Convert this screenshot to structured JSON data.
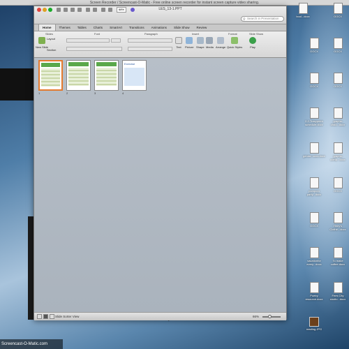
{
  "recorder": {
    "title": "Screen Recorder / Screencast-O-Matic - Free online screen recorder for instant screen capture video sharing."
  },
  "window": {
    "doc_title": "LES_13-1.PPT",
    "zoom_box": "68%",
    "search_placeholder": "Search in Presentation"
  },
  "tabs": [
    "Home",
    "Themes",
    "Tables",
    "Charts",
    "SmartArt",
    "Transitions",
    "Animations",
    "Slide Show",
    "Review"
  ],
  "ribbon": {
    "groups": [
      "Slides",
      "Font",
      "Paragraph",
      "Insert",
      "Format",
      "Slide Show"
    ],
    "buttons": {
      "new_slide": "New Slide",
      "layout": "Layout",
      "section": "Section",
      "text": "Text",
      "picture": "Picture",
      "shape": "Shape",
      "media": "Media",
      "arrange": "Arrange",
      "quick_styles": "Quick Styles",
      "play": "Play"
    }
  },
  "slides": [
    {
      "num": "1",
      "title": ""
    },
    {
      "num": "2",
      "title": ""
    },
    {
      "num": "3",
      "title": ""
    },
    {
      "num": "4",
      "title": "Exercise"
    }
  ],
  "status": {
    "view_label": "Slide Sorter View",
    "zoom": "66%"
  },
  "desktop": {
    "icons": [
      {
        "label": "bool...docx",
        "type": "doc"
      },
      {
        "label": "OOCX",
        "type": "doc"
      },
      {
        "label": "OOCX",
        "type": "doc"
      },
      {
        "label": "OOCX",
        "type": "doc"
      },
      {
        "label": "OOCX",
        "type": "doc"
      },
      {
        "label": "OOCX",
        "type": "doc"
      },
      {
        "label": "2.2.Tracyprem schedule.docx",
        "type": "doc"
      },
      {
        "label": "graphic chdo...docx",
        "type": "doc"
      },
      {
        "label": "gender roles.docx",
        "type": "doc"
      },
      {
        "label": "graphic comp...docx",
        "type": "doc"
      },
      {
        "label": "pompom party...docx",
        "type": "doc"
      },
      {
        "label": "OOCX",
        "type": "doc"
      },
      {
        "label": "OOCX",
        "type": "doc"
      },
      {
        "label": "Heey's Clothe...docx",
        "type": "doc"
      },
      {
        "label": "vacationfor every...docx",
        "type": "doc"
      },
      {
        "label": "To make coffee.docx",
        "type": "doc"
      },
      {
        "label": "Poetry resource.docx",
        "type": "doc"
      },
      {
        "label": "Fees City studio...docx",
        "type": "doc"
      },
      {
        "label": "reading.JPG",
        "type": "img"
      }
    ]
  },
  "watermark": "Screencast-O-Matic.com"
}
